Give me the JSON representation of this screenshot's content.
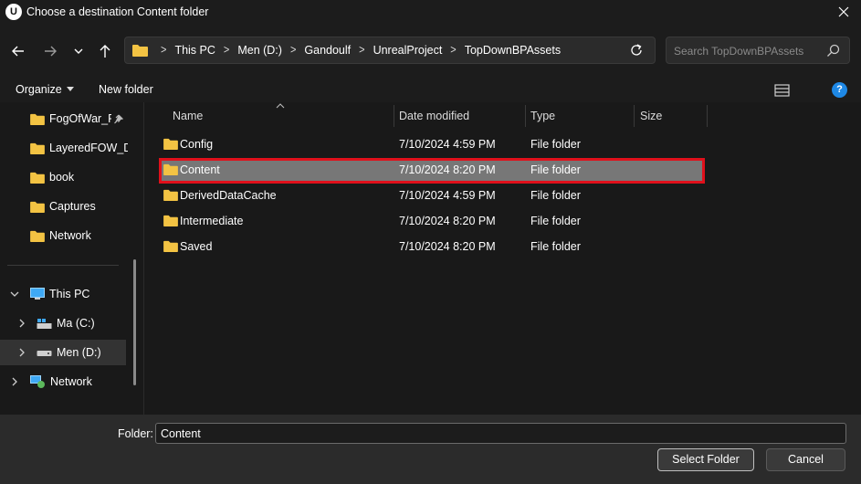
{
  "window": {
    "app_logo": "U",
    "title": "Choose a destination Content folder"
  },
  "address": {
    "crumbs": [
      "This PC",
      "Men (D:)",
      "Gandoulf",
      "UnrealProject",
      "TopDownBPAssets"
    ]
  },
  "search": {
    "placeholder": "Search TopDownBPAssets"
  },
  "toolbar": {
    "organize": "Organize",
    "new_folder": "New folder",
    "help": "?"
  },
  "sidebar": {
    "quick": [
      "FogOfWar_Pl",
      "LayeredFOW_De",
      "book",
      "Captures",
      "Network"
    ],
    "tree": [
      {
        "label": "This PC",
        "icon": "this-pc-icon",
        "expanded": true
      },
      {
        "label": "Ma (C:)",
        "icon": "drive-c-icon"
      },
      {
        "label": "Men (D:)",
        "icon": "drive-d-icon",
        "selected": true
      },
      {
        "label": "Network",
        "icon": "network-icon"
      }
    ]
  },
  "columns": {
    "name": "Name",
    "date": "Date modified",
    "type": "Type",
    "size": "Size"
  },
  "files": [
    {
      "name": "Config",
      "date": "7/10/2024 4:59 PM",
      "type": "File folder"
    },
    {
      "name": "Content",
      "date": "7/10/2024 8:20 PM",
      "type": "File folder"
    },
    {
      "name": "DerivedDataCache",
      "date": "7/10/2024 4:59 PM",
      "type": "File folder"
    },
    {
      "name": "Intermediate",
      "date": "7/10/2024 8:20 PM",
      "type": "File folder"
    },
    {
      "name": "Saved",
      "date": "7/10/2024 8:20 PM",
      "type": "File folder"
    }
  ],
  "footer": {
    "folder_label": "Folder:",
    "folder_value": "Content",
    "select_label": "Select Folder",
    "cancel_label": "Cancel"
  },
  "colors": {
    "highlight": "#e0101b",
    "folder": "#f3c343",
    "selection": "#777777",
    "help": "#1e88e5"
  }
}
